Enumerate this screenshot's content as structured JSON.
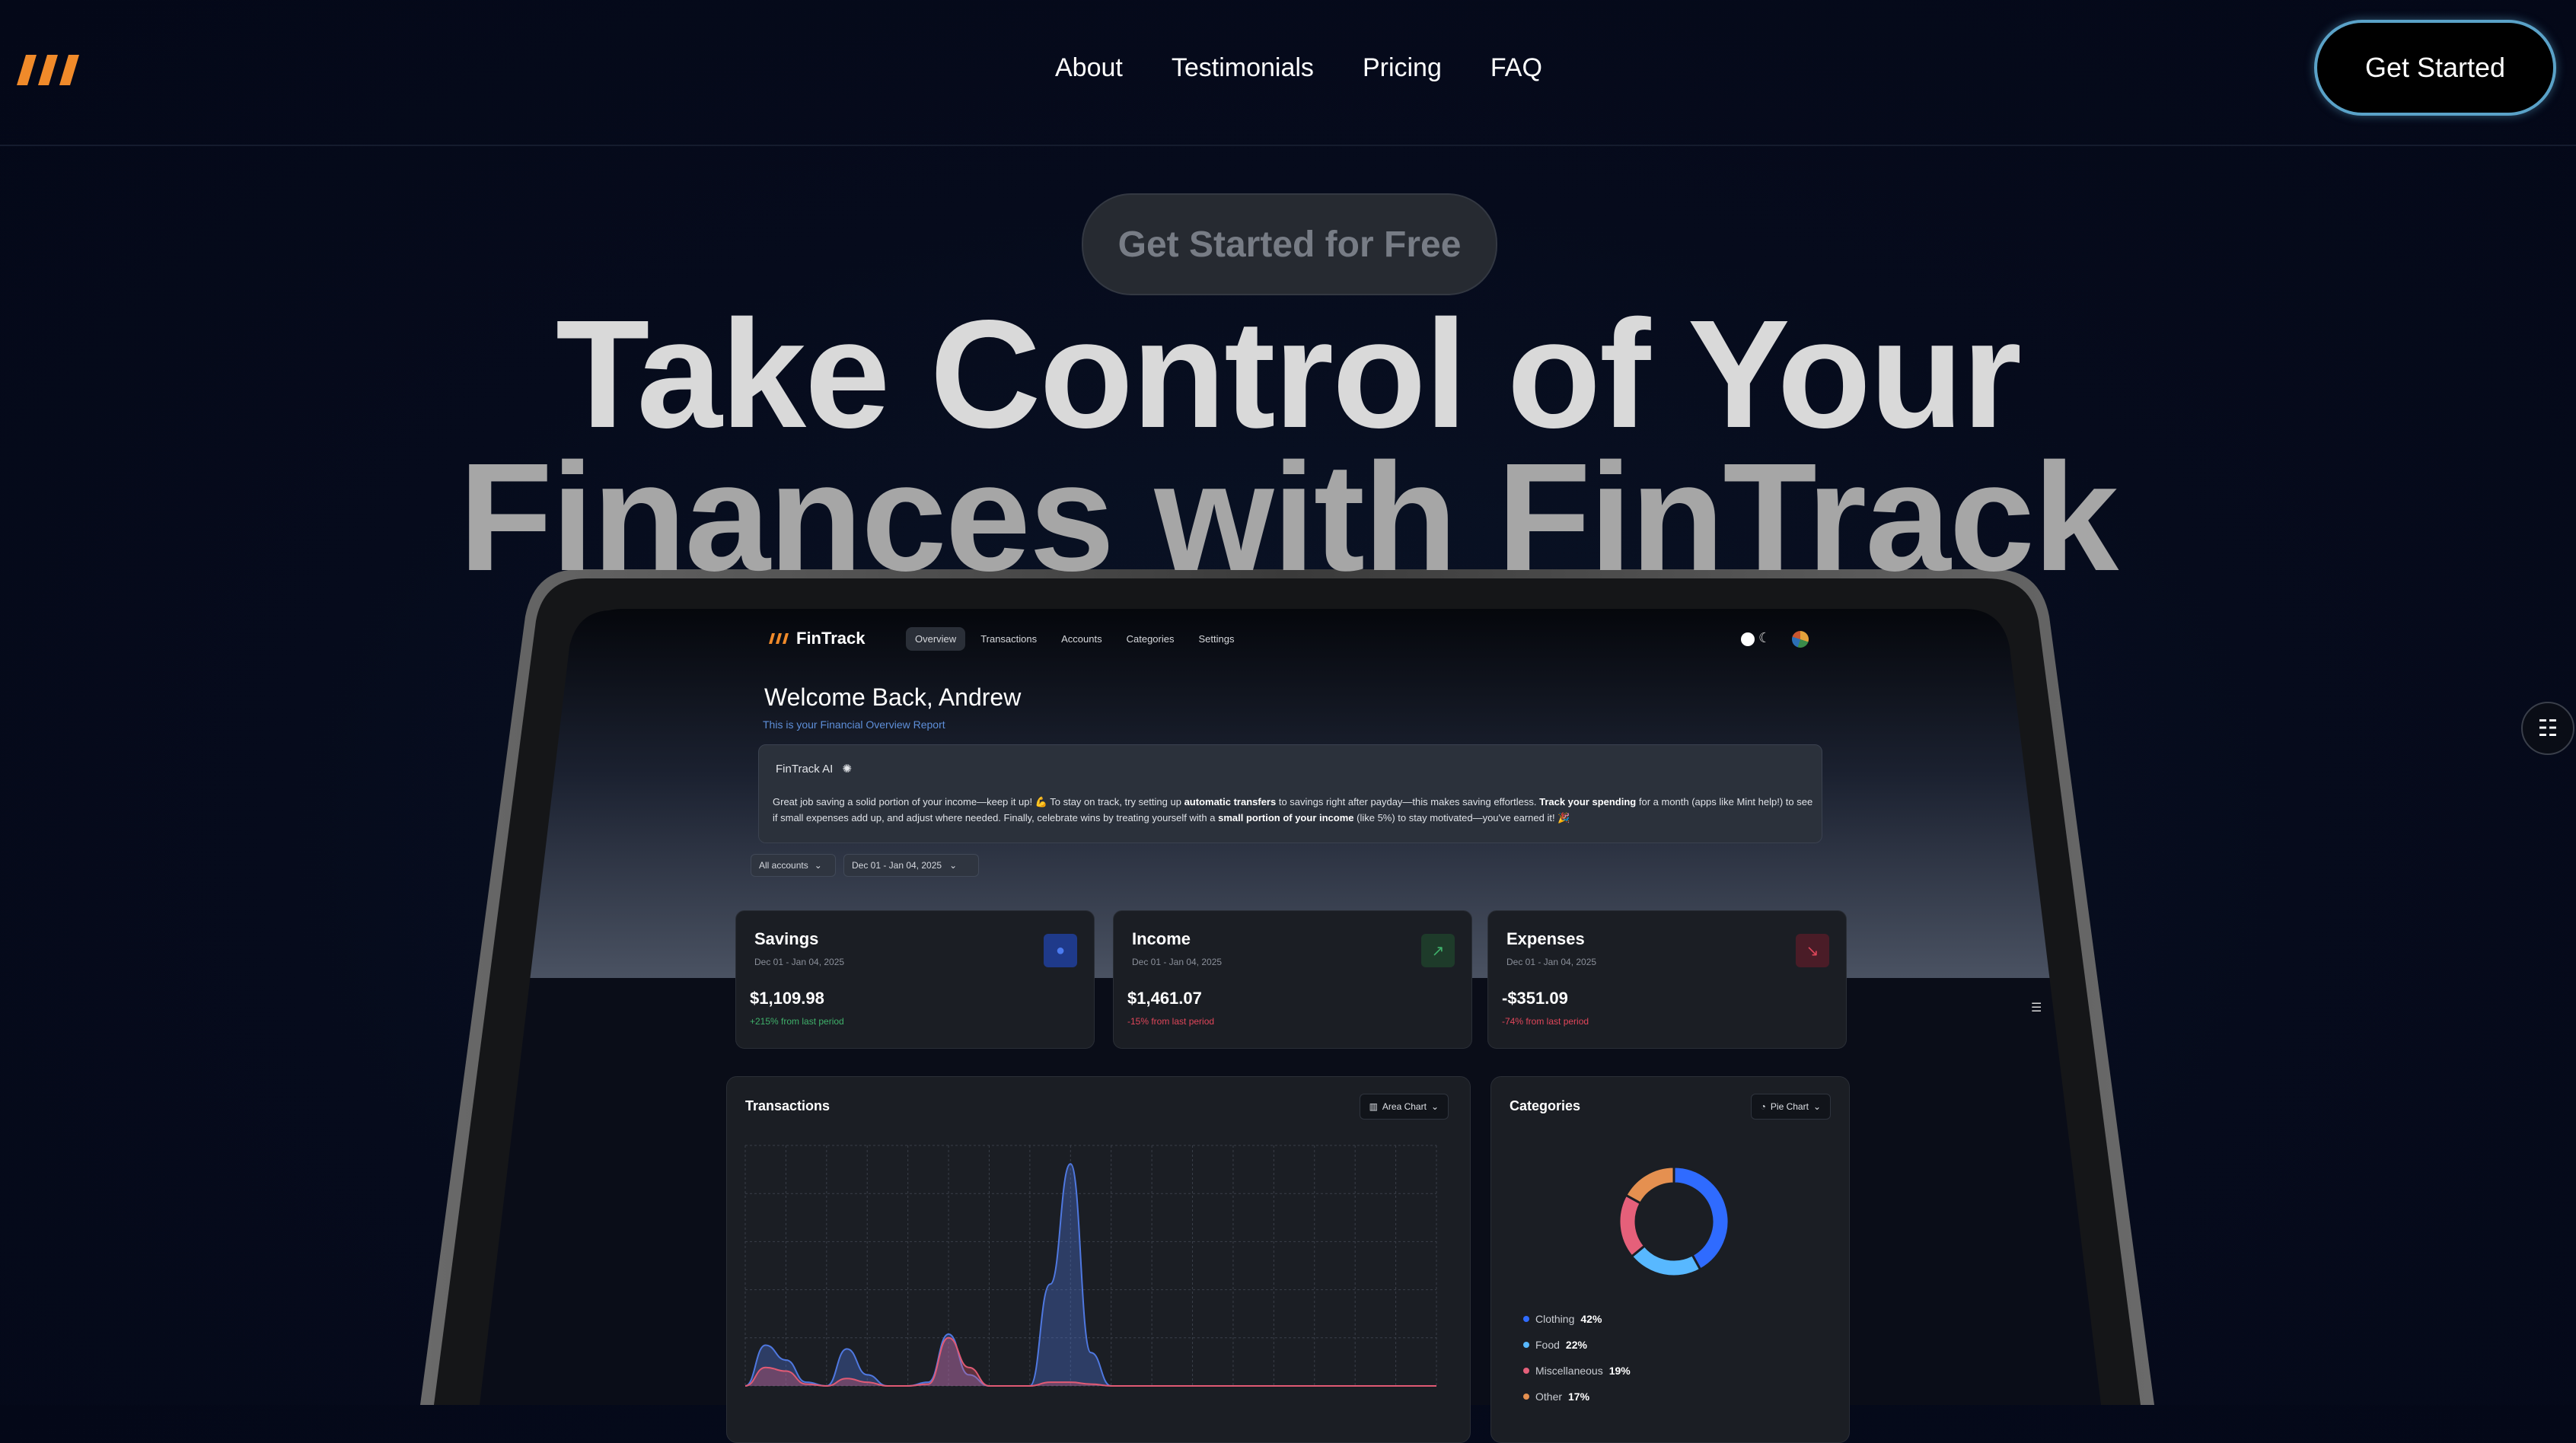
{
  "nav": {
    "links": [
      "About",
      "Testimonials",
      "Pricing",
      "FAQ"
    ],
    "cta": "Get Started"
  },
  "hero": {
    "pill": "Get Started for Free",
    "title_line1": "Take Control of Your",
    "title_line2": "Finances with FinTrack"
  },
  "dashboard": {
    "brand": "FinTrack",
    "tabs": [
      "Overview",
      "Transactions",
      "Accounts",
      "Categories",
      "Settings"
    ],
    "active_tab": "Overview",
    "welcome": "Welcome Back, Andrew",
    "subtitle": "This is your Financial Overview Report",
    "ai": {
      "title": "FinTrack AI",
      "text_parts": [
        "Great job saving a solid portion of your income—keep it up! 💪 To stay on track, try setting up ",
        "automatic transfers",
        " to savings right after payday—this makes saving effortless. ",
        "Track your spending",
        " for a month (apps like Mint help!) to see if small expenses add up, and adjust where needed. Finally, celebrate wins by treating yourself with a ",
        "small portion of your income",
        " (like 5%) to stay motivated—you've earned it! 🎉"
      ]
    },
    "filters": {
      "accounts": "All accounts",
      "date": "Dec 01 - Jan 04, 2025"
    },
    "stats": [
      {
        "title": "Savings",
        "date": "Dec 01 - Jan 04, 2025",
        "value": "$1,109.98",
        "change": "+215% from last period",
        "change_color": "#3fb06a",
        "icon": "piggy-bank-icon",
        "icon_bg": "#1f3a8a",
        "icon_fg": "#4b7bf0"
      },
      {
        "title": "Income",
        "date": "Dec 01 - Jan 04, 2025",
        "value": "$1,461.07",
        "change": "-15% from last period",
        "change_color": "#e0465a",
        "icon": "trending-up-icon",
        "icon_bg": "#1e3b2a",
        "icon_fg": "#3fb06a"
      },
      {
        "title": "Expenses",
        "date": "Dec 01 - Jan 04, 2025",
        "value": "-$351.09",
        "change": "-74% from last period",
        "change_color": "#e0465a",
        "icon": "trending-down-icon",
        "icon_bg": "#4a1c27",
        "icon_fg": "#e0465a"
      }
    ],
    "transactions": {
      "title": "Transactions",
      "chart_type_button": "Area Chart"
    },
    "categories": {
      "title": "Categories",
      "chart_type_button": "Pie Chart"
    }
  },
  "chart_data": [
    {
      "type": "area",
      "title": "Transactions",
      "x": [
        0,
        1,
        2,
        3,
        4,
        5,
        6,
        7,
        8,
        9,
        10,
        11,
        12,
        13,
        14,
        15,
        16,
        17,
        18,
        19,
        20,
        21,
        22,
        23,
        24,
        25,
        26,
        27,
        28,
        29,
        30,
        31,
        32,
        33,
        34
      ],
      "series": [
        {
          "color": "#4f78e0",
          "values": [
            0,
            22,
            14,
            2,
            0,
            20,
            6,
            0,
            0,
            2,
            28,
            6,
            0,
            0,
            0,
            55,
            120,
            18,
            0,
            0,
            0,
            0,
            0,
            0,
            0,
            0,
            0,
            0,
            0,
            0,
            0,
            0,
            0,
            0,
            0
          ]
        },
        {
          "color": "#e05a74",
          "values": [
            0,
            10,
            8,
            1,
            0,
            4,
            2,
            0,
            0,
            1,
            26,
            10,
            0,
            0,
            0,
            2,
            2,
            1,
            0,
            0,
            0,
            0,
            0,
            0,
            0,
            0,
            0,
            0,
            0,
            0,
            0,
            0,
            0,
            0,
            0
          ]
        }
      ],
      "ylim": [
        0,
        130
      ]
    },
    {
      "type": "pie",
      "title": "Categories",
      "categories": [
        "Clothing",
        "Food",
        "Miscellaneous",
        "Other"
      ],
      "values": [
        42,
        22,
        19,
        17
      ],
      "colors": [
        "#2f6bff",
        "#58b8ff",
        "#e5607a",
        "#e59050"
      ]
    }
  ]
}
